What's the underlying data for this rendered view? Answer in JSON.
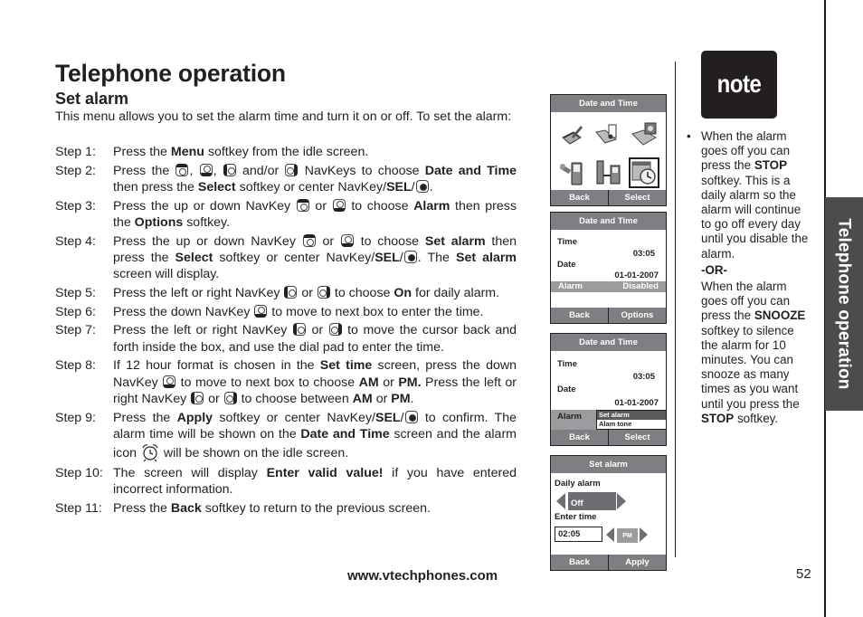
{
  "page": {
    "title": "Telephone operation",
    "section_title": "Set alarm",
    "intro": "This menu allows you to set the alarm time and turn it on or off. To set the alarm:",
    "side_tab": "Telephone operation",
    "footer_url": "www.vtechphones.com",
    "page_number": "52"
  },
  "steps": [
    {
      "label": "Step 1:",
      "parts": [
        [
          "t",
          "Press the "
        ],
        [
          "b",
          "Menu"
        ],
        [
          "t",
          " softkey from the idle screen."
        ]
      ]
    },
    {
      "label": "Step  2:",
      "parts": [
        [
          "t",
          "Press the "
        ],
        [
          "k",
          "up"
        ],
        [
          "t",
          ", "
        ],
        [
          "k",
          "down"
        ],
        [
          "t",
          ", "
        ],
        [
          "k",
          "left"
        ],
        [
          "t",
          " and/or "
        ],
        [
          "k",
          "right"
        ],
        [
          "t",
          " NavKeys to choose "
        ],
        [
          "b",
          "Date and Time"
        ],
        [
          "t",
          " then press the "
        ],
        [
          "b",
          "Select"
        ],
        [
          "t",
          " softkey or center NavKey/"
        ],
        [
          "b",
          "SEL"
        ],
        [
          "t",
          "/"
        ],
        [
          "k",
          "center"
        ],
        [
          "t",
          "."
        ]
      ]
    },
    {
      "label": "Step 3:",
      "parts": [
        [
          "t",
          "Press the up or down NavKey "
        ],
        [
          "k",
          "up"
        ],
        [
          "t",
          " or "
        ],
        [
          "k",
          "down"
        ],
        [
          "t",
          " to choose "
        ],
        [
          "b",
          "Alarm"
        ],
        [
          "t",
          " then press the "
        ],
        [
          "b",
          "Options"
        ],
        [
          "t",
          " softkey."
        ]
      ]
    },
    {
      "label": "Step 4:",
      "parts": [
        [
          "t",
          "Press the up or down NavKey "
        ],
        [
          "k",
          "up"
        ],
        [
          "t",
          " or "
        ],
        [
          "k",
          "down"
        ],
        [
          "t",
          " to choose "
        ],
        [
          "b",
          "Set alarm"
        ],
        [
          "t",
          " then press the "
        ],
        [
          "b",
          "Select"
        ],
        [
          "t",
          " softkey or center NavKey/"
        ],
        [
          "b",
          "SEL"
        ],
        [
          "t",
          "/"
        ],
        [
          "k",
          "center"
        ],
        [
          "t",
          ". The "
        ],
        [
          "b",
          "Set alarm"
        ],
        [
          "t",
          " screen will display."
        ]
      ]
    },
    {
      "label": "Step 5:",
      "parts": [
        [
          "t",
          "Press the left or right NavKey "
        ],
        [
          "k",
          "left"
        ],
        [
          "t",
          " or "
        ],
        [
          "k",
          "right"
        ],
        [
          "t",
          " to choose "
        ],
        [
          "b",
          "On"
        ],
        [
          "t",
          " for daily alarm."
        ]
      ]
    },
    {
      "label": "Step 6:",
      "parts": [
        [
          "t",
          "Press the down NavKey "
        ],
        [
          "k",
          "down"
        ],
        [
          "t",
          " to move to next box to enter the time."
        ]
      ]
    },
    {
      "label": "Step 7:",
      "parts": [
        [
          "t",
          "Press the left or right NavKey "
        ],
        [
          "k",
          "left"
        ],
        [
          "t",
          " or "
        ],
        [
          "k",
          "right"
        ],
        [
          "t",
          " to move the cursor back and forth inside the box, and use the dial pad to enter the time."
        ]
      ]
    },
    {
      "label": "Step 8:",
      "parts": [
        [
          "t",
          "If 12 hour format is chosen in the "
        ],
        [
          "b",
          "Set time"
        ],
        [
          "t",
          " screen, press the down NavKey "
        ],
        [
          "k",
          "down"
        ],
        [
          "t",
          " to move to next box to choose "
        ],
        [
          "b",
          "AM"
        ],
        [
          "t",
          " or "
        ],
        [
          "b",
          "PM."
        ],
        [
          "t",
          " Press the left or right NavKey "
        ],
        [
          "k",
          "left"
        ],
        [
          "t",
          " or "
        ],
        [
          "k",
          "right"
        ],
        [
          "t",
          " to choose between "
        ],
        [
          "b",
          "AM"
        ],
        [
          "t",
          " or "
        ],
        [
          "b",
          "PM"
        ],
        [
          "t",
          "."
        ]
      ]
    },
    {
      "label": "Step 9:",
      "parts": [
        [
          "t",
          "Press the "
        ],
        [
          "b",
          "Apply"
        ],
        [
          "t",
          " softkey or center NavKey/"
        ],
        [
          "b",
          "SEL"
        ],
        [
          "t",
          "/"
        ],
        [
          "k",
          "center"
        ],
        [
          "t",
          " to confirm. The alarm time will be shown on the "
        ],
        [
          "b",
          "Date and Time"
        ],
        [
          "t",
          " screen and the alarm icon "
        ],
        [
          "a",
          "alarm"
        ],
        [
          "t",
          " will be shown on the idle screen."
        ]
      ]
    },
    {
      "label": "Step 10:",
      "parts": [
        [
          "t",
          "The screen will display "
        ],
        [
          "b",
          "Enter valid value!"
        ],
        [
          "t",
          " if you have entered incorrect information."
        ]
      ]
    },
    {
      "label": "Step 11:",
      "parts": [
        [
          "t",
          "Press the "
        ],
        [
          "b",
          "Back"
        ],
        [
          "t",
          " softkey to return to the previous screen."
        ]
      ]
    }
  ],
  "note": {
    "badge": "note",
    "bullet": "•",
    "first_parts": [
      [
        "t",
        "When the alarm goes off you can press the "
      ],
      [
        "b",
        "STOP"
      ],
      [
        "t",
        " softkey. This is a daily alarm so the alarm will continue to go off every day until you disable the alarm."
      ]
    ],
    "or": "-OR-",
    "second_parts": [
      [
        "t",
        "When the alarm goes off you can press the "
      ],
      [
        "b",
        "SNOOZE"
      ],
      [
        "t",
        " softkey to silence the alarm for 10 minutes. You can snooze as many times as you want until you press the "
      ],
      [
        "b",
        "STOP"
      ],
      [
        "t",
        " softkey."
      ]
    ]
  },
  "screens": {
    "menu": {
      "title": "Date and Time",
      "icons": [
        "notepad-icon",
        "music-folder-icon",
        "picture-folder-icon",
        "settings-phone-icon",
        "intercom-icon",
        "date-time-icon"
      ],
      "selected_index": 5,
      "left_softkey": "Back",
      "right_softkey": "Select"
    },
    "date_time": {
      "title": "Date and Time",
      "time_label": "Time",
      "time_value": "03:05",
      "date_label": "Date",
      "date_value": "01-01-2007",
      "alarm_label": "Alarm",
      "alarm_value": "Disabled",
      "left_softkey": "Back",
      "right_softkey": "Options"
    },
    "date_time_options": {
      "title": "Date and Time",
      "time_label": "Time",
      "time_value": "03:05",
      "date_label": "Date",
      "date_value": "01-01-2007",
      "alarm_label": "Alarm",
      "options": [
        "Set alarm",
        "Alam tone"
      ],
      "selected_option": 0,
      "left_softkey": "Back",
      "right_softkey": "Select"
    },
    "set_alarm": {
      "title": "Set alarm",
      "daily_label": "Daily alarm",
      "daily_value": "Off",
      "time_label": "Enter time",
      "time_value": "02:05",
      "ampm_value": "PM",
      "left_softkey": "Back",
      "right_softkey": "Apply"
    }
  },
  "colors": {
    "screen_header": "#7d7f82",
    "tab_bg": "#4d4b4c",
    "text": "#231f20"
  }
}
